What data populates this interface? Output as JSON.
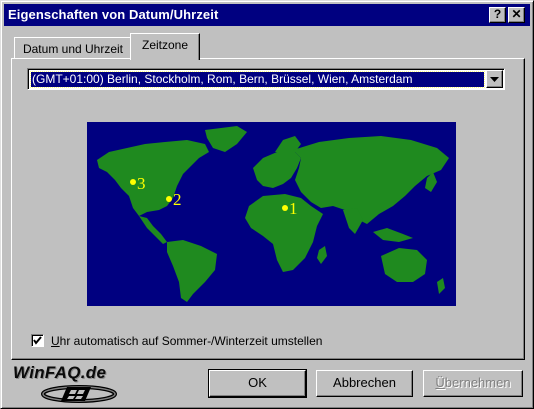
{
  "window": {
    "title": "Eigenschaften von Datum/Uhrzeit",
    "help_button": "?",
    "close_button": "✕"
  },
  "tabs": [
    {
      "label": "Datum und Uhrzeit",
      "selected": false
    },
    {
      "label": "Zeitzone",
      "selected": true
    }
  ],
  "timezone": {
    "selected": "(GMT+01:00) Berlin, Stockholm, Rom, Bern, Brüssel, Wien, Amsterdam"
  },
  "map": {
    "ocean_color": "#000080",
    "land_color": "#1f8a1f",
    "marker_color": "#ffff00",
    "markers": [
      {
        "label": "1"
      },
      {
        "label": "2"
      },
      {
        "label": "3"
      }
    ]
  },
  "dst": {
    "checked": true,
    "label_mnemonic": "U",
    "label_rest": "hr automatisch auf Sommer-/Winterzeit umstellen"
  },
  "logo": {
    "text": "WinFAQ.de"
  },
  "buttons": {
    "ok": "OK",
    "cancel": "Abbrechen",
    "apply_mnemonic": "Ü",
    "apply_rest": "bernehmen"
  }
}
